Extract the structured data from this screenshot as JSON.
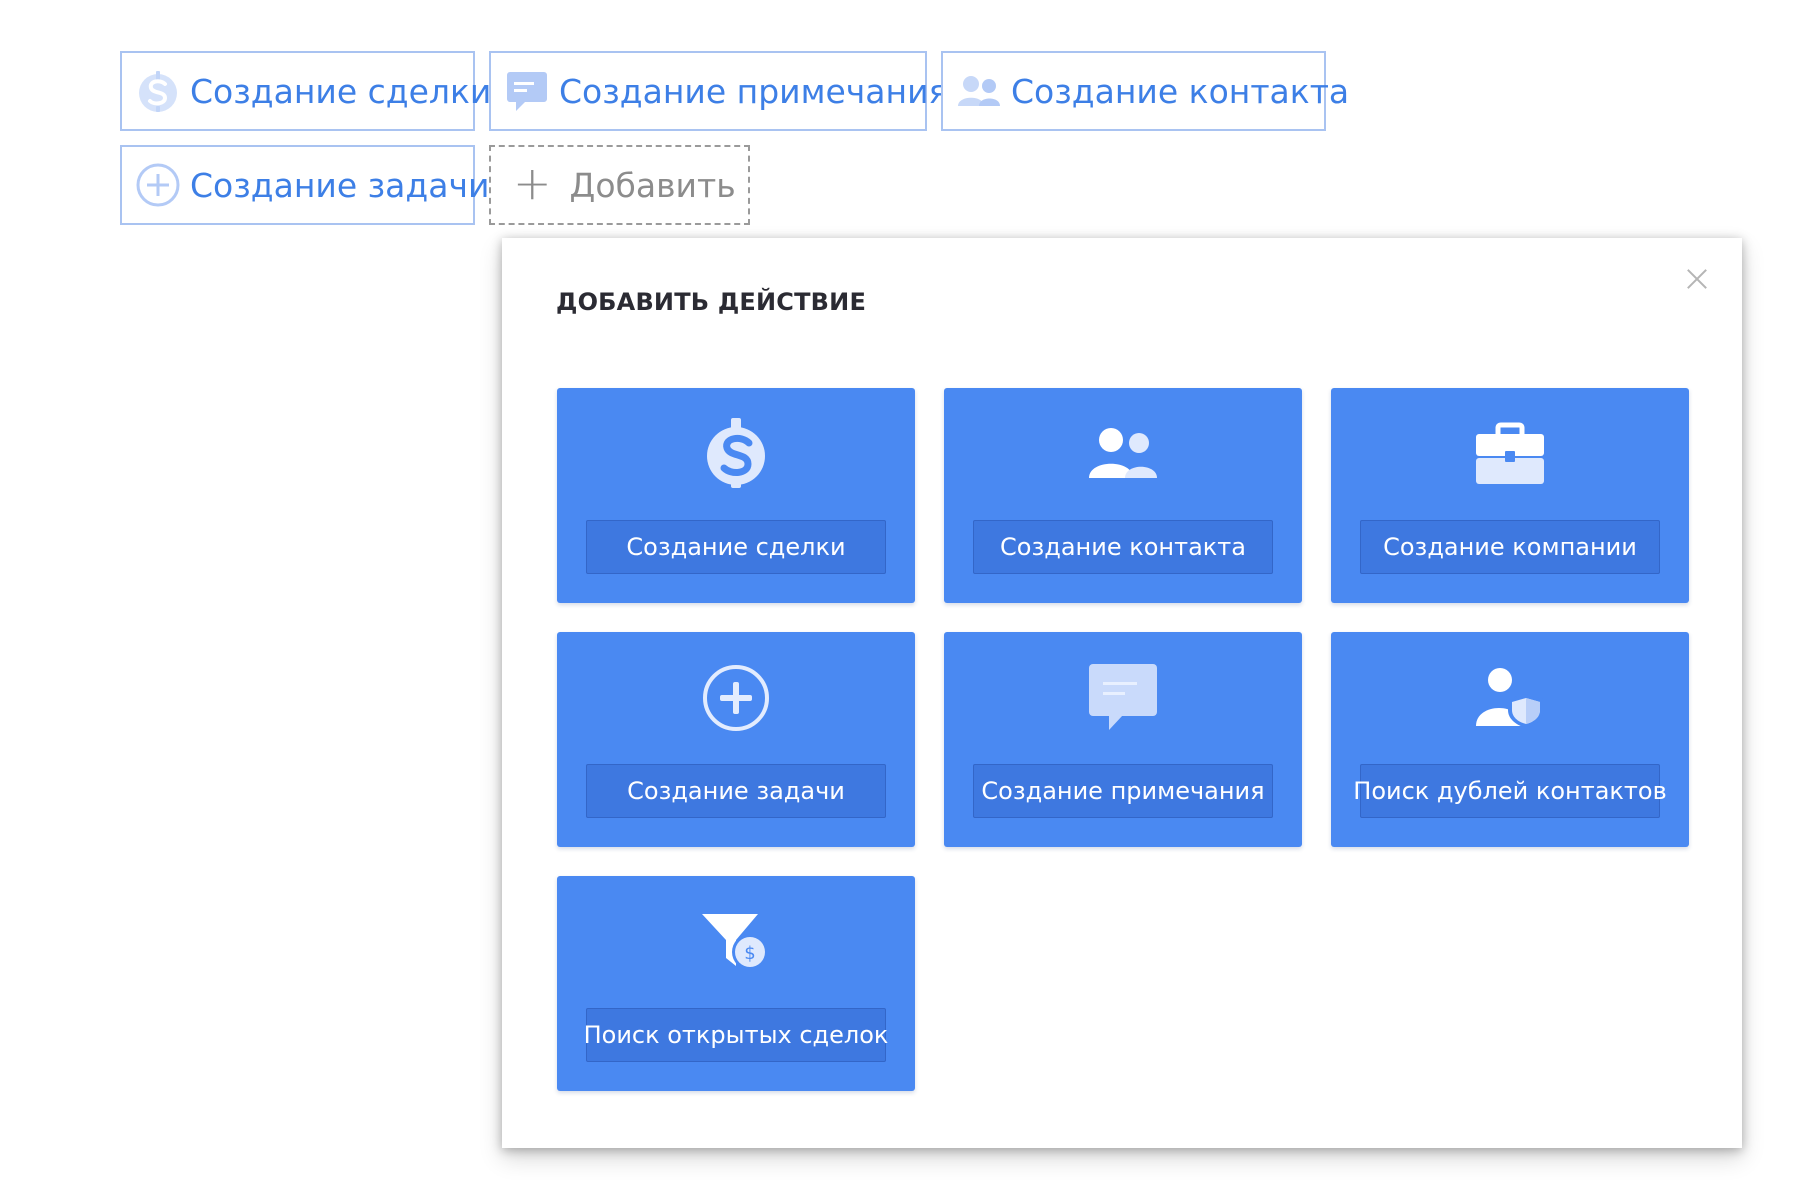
{
  "chips": [
    {
      "label": "Создание сделки",
      "icon": "dollar-icon"
    },
    {
      "label": "Создание примечания",
      "icon": "note-icon"
    },
    {
      "label": "Создание контакта",
      "icon": "contacts-icon"
    },
    {
      "label": "Создание задачи",
      "icon": "plus-circle-icon"
    }
  ],
  "add_button": {
    "label": "Добавить",
    "icon": "plus-icon"
  },
  "modal": {
    "title": "ДОБАВИТЬ ДЕЙСТВИЕ",
    "close_icon": "close-icon",
    "actions": [
      {
        "label": "Создание сделки",
        "icon": "dollar-icon"
      },
      {
        "label": "Создание контакта",
        "icon": "contacts-icon"
      },
      {
        "label": "Создание компании",
        "icon": "briefcase-icon"
      },
      {
        "label": "Создание задачи",
        "icon": "plus-circle-icon"
      },
      {
        "label": "Создание примечания",
        "icon": "note-icon"
      },
      {
        "label": "Поиск дублей контактов",
        "icon": "user-shield-icon"
      },
      {
        "label": "Поиск открытых сделок",
        "icon": "funnel-dollar-icon"
      }
    ]
  },
  "colors": {
    "accent": "#4a89f2",
    "accent_dark": "#3e78e0",
    "chip_text": "#3d7fe6",
    "chip_border": "#a9c3f1",
    "icon_light": "#c9dafb"
  }
}
